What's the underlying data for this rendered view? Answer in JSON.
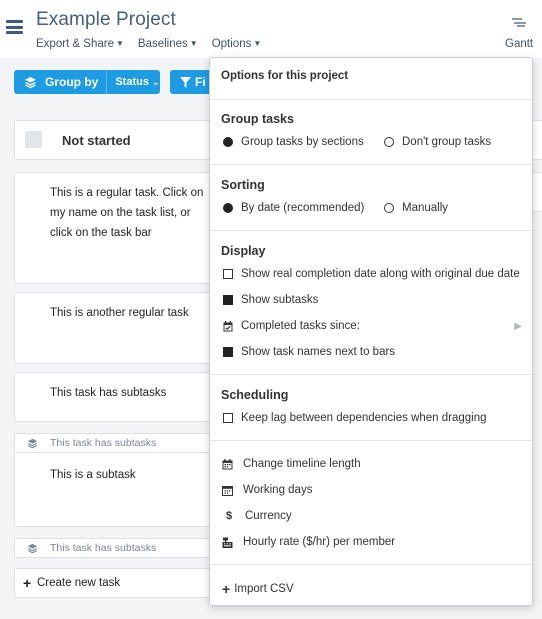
{
  "header": {
    "title": "Example Project",
    "menus": [
      {
        "label": "Export & Share"
      },
      {
        "label": "Baselines"
      },
      {
        "label": "Options"
      }
    ],
    "view_label": "Gantt"
  },
  "toolbar": {
    "group_by_label": "Group by",
    "group_by_value": "Status",
    "filter_label": "Fi"
  },
  "column": {
    "title": "Not started"
  },
  "tasks": [
    {
      "text": "This is a regular task. Click on my name on the task list, or click on the task bar"
    },
    {
      "text": "This is another regular task"
    },
    {
      "text": "This task has subtasks"
    }
  ],
  "subtask_groups": [
    {
      "header": "This task has subtasks",
      "subtask": "This is a subtask"
    },
    {
      "header": "This task has subtasks"
    }
  ],
  "create_label": "Create new task",
  "options_menu": {
    "title": "Options for this project",
    "group_tasks": {
      "title": "Group tasks",
      "options": [
        {
          "label": "Group tasks by sections",
          "selected": true
        },
        {
          "label": "Don't group tasks",
          "selected": false
        }
      ]
    },
    "sorting": {
      "title": "Sorting",
      "options": [
        {
          "label": "By date (recommended)",
          "selected": true
        },
        {
          "label": "Manually",
          "selected": false
        }
      ]
    },
    "display": {
      "title": "Display",
      "items": [
        {
          "label": "Show real completion date along with original due date",
          "checked": false
        },
        {
          "label": "Show subtasks",
          "checked": true
        },
        {
          "label": "Completed tasks since:",
          "icon": "calendar-check-icon"
        },
        {
          "label": "Show task names next to bars",
          "checked": true
        }
      ]
    },
    "scheduling": {
      "title": "Scheduling",
      "items": [
        {
          "label": "Keep lag between dependencies when dragging",
          "checked": false
        }
      ]
    },
    "settings": [
      {
        "label": "Change timeline length",
        "icon": "calendar-icon"
      },
      {
        "label": "Working days",
        "icon": "calendar-days-icon"
      },
      {
        "label": "Currency",
        "icon": "dollar-icon"
      },
      {
        "label": "Hourly rate ($/hr) per member",
        "icon": "cash-register-icon"
      }
    ],
    "import_label": "Import CSV"
  }
}
